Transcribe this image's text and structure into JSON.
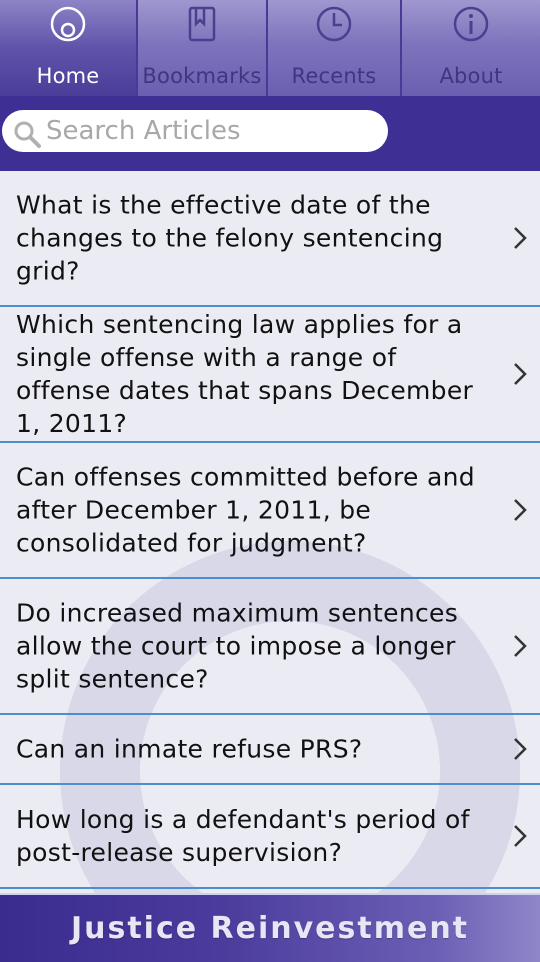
{
  "tabs": [
    {
      "label": "Home",
      "icon": "home-icon",
      "active": true
    },
    {
      "label": "Bookmarks",
      "icon": "bookmark-icon",
      "active": false
    },
    {
      "label": "Recents",
      "icon": "clock-icon",
      "active": false
    },
    {
      "label": "About",
      "icon": "info-icon",
      "active": false
    }
  ],
  "search": {
    "placeholder": "Search Articles",
    "value": ""
  },
  "articles": [
    {
      "title": "What is the effective date of the changes to the felony sentencing grid?"
    },
    {
      "title": "Which sentencing law applies for a single offense with a range of offense dates that spans December 1, 2011?"
    },
    {
      "title": "Can offenses committed before and after December 1, 2011, be consolidated for judgment?"
    },
    {
      "title": "Do increased maximum sentences allow the court to impose a longer split sentence?"
    },
    {
      "title": "Can an inmate refuse PRS?"
    },
    {
      "title": "How long is a defendant's period of post-release supervision?"
    }
  ],
  "footer": {
    "brand": "Justice Reinvestment"
  },
  "colors": {
    "header": "#3e2f94",
    "divider": "#4a8fd0",
    "list_bg": "#ebebf4"
  }
}
